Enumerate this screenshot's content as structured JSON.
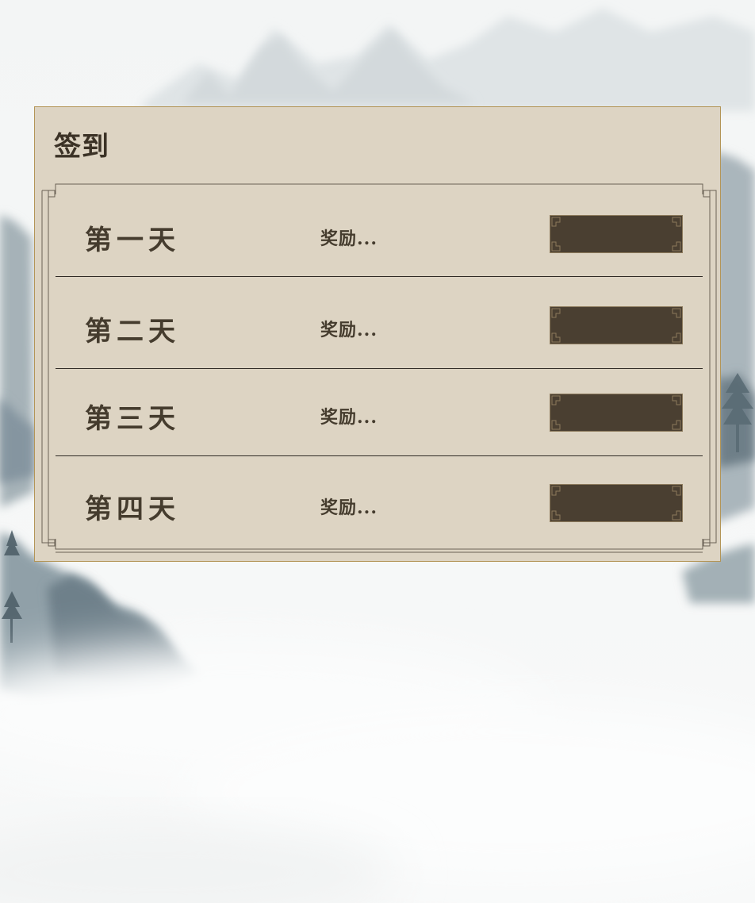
{
  "checkin": {
    "title": "签到",
    "days": [
      {
        "day": "第一天",
        "reward": "奖励...",
        "button": ""
      },
      {
        "day": "第二天",
        "reward": "奖励...",
        "button": ""
      },
      {
        "day": "第三天",
        "reward": "奖励...",
        "button": ""
      },
      {
        "day": "第四天",
        "reward": "奖励...",
        "button": ""
      }
    ]
  },
  "colors": {
    "panel_bg": "#ddd4c3",
    "panel_border": "#b39557",
    "text": "#453c2e",
    "button_fill": "#4a3f31",
    "button_trim": "#8c7a5c"
  }
}
